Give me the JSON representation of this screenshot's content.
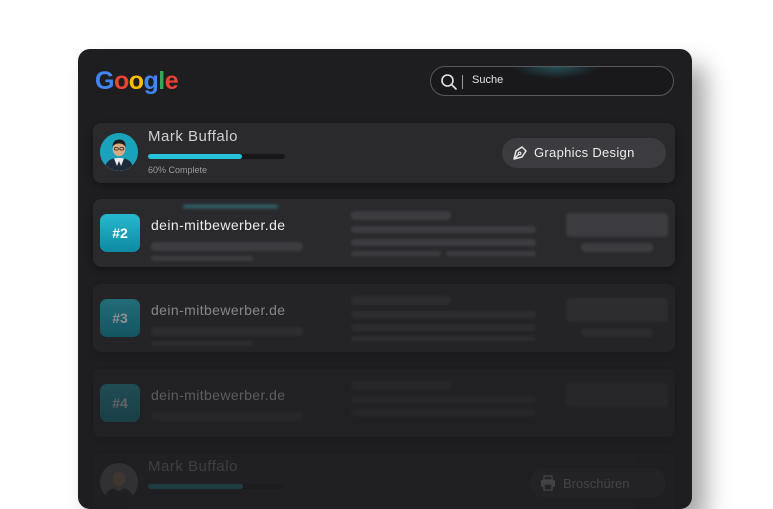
{
  "header": {
    "logo_letters": [
      "G",
      "o",
      "o",
      "g",
      "l",
      "e"
    ],
    "logo_colors": [
      "#4285F4",
      "#EA4335",
      "#FBBC05",
      "#4285F4",
      "#34A853",
      "#EA4335"
    ],
    "search": {
      "value": "Suche",
      "icon": "search-icon"
    }
  },
  "profile": {
    "name": "Mark Buffalo",
    "progress_percent": 60,
    "progress_text": "60% Complete",
    "tag_icon": "pen-tool-icon",
    "tag_label": "Graphics Design"
  },
  "results": [
    {
      "rank": "#2",
      "domain": "dein-mitbewerber.de"
    },
    {
      "rank": "#3",
      "domain": "dein-mitbewerber.de"
    },
    {
      "rank": "#4",
      "domain": "dein-mitbewerber.de"
    }
  ],
  "bottom_profile": {
    "name": "Mark Buffalo",
    "tag_icon": "printer-icon",
    "tag_label": "Broschüren"
  },
  "colors": {
    "accent": "#25C3DC",
    "panel": "#1E1E20",
    "card": "#2A2A2D"
  }
}
